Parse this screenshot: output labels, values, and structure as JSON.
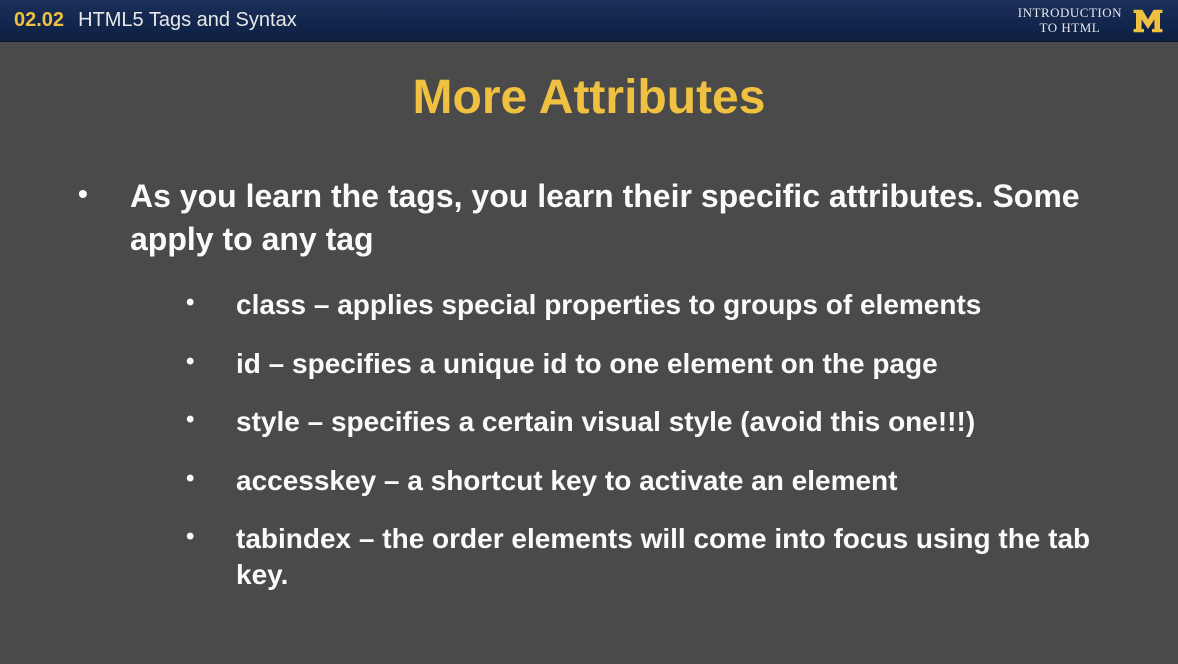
{
  "header": {
    "slide_number": "02.02",
    "lecture_title": "HTML5 Tags and Syntax",
    "course_line1": "INTRODUCTION",
    "course_line2": "TO HTML"
  },
  "slide": {
    "title": "More Attributes",
    "main_bullet": "As you learn the tags, you learn their specific attributes. Some apply to any tag",
    "sub_bullets": [
      "class – applies special properties to groups of elements",
      "id – specifies a unique id to one element on the page",
      "style – specifies a certain visual style (avoid this one!!!)",
      "accesskey – a shortcut key to activate an element",
      "tabindex – the order elements will come into focus using the tab key."
    ]
  },
  "colors": {
    "accent": "#f0c040",
    "header_bg": "#0d1f42",
    "body_bg": "#4a4a4a",
    "text": "#ffffff"
  }
}
